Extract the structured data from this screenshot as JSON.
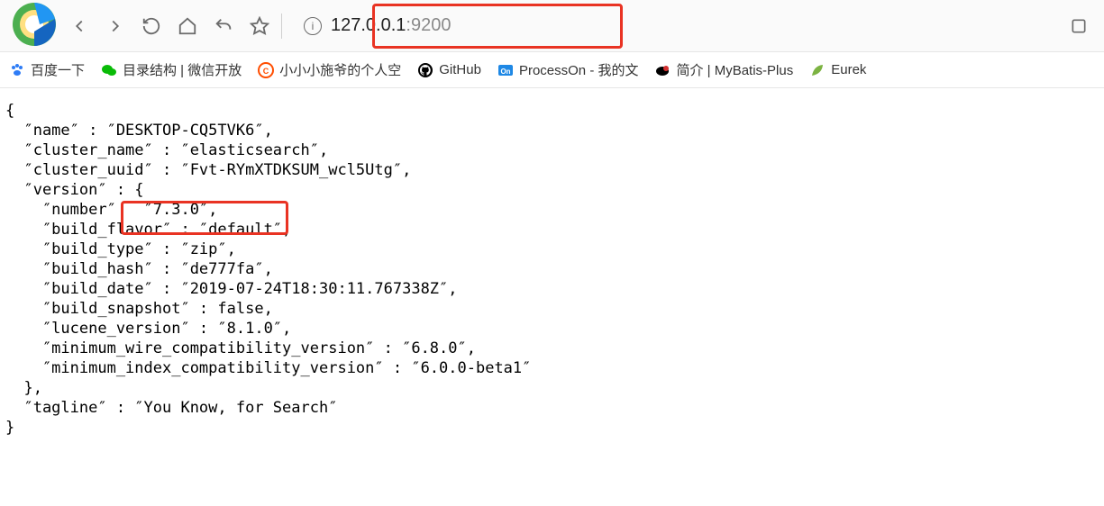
{
  "address": {
    "host": "127.0.0.1",
    "port": ":9200"
  },
  "bookmarks": [
    {
      "label": "百度一下"
    },
    {
      "label": "目录结构 | 微信开放"
    },
    {
      "label": "小小小施爷的个人空"
    },
    {
      "label": "GitHub"
    },
    {
      "label": "ProcessOn - 我的文"
    },
    {
      "label": "简介 | MyBatis-Plus"
    },
    {
      "label": "Eurek"
    }
  ],
  "json": {
    "name": "DESKTOP-CQ5TVK6",
    "cluster_name": "elasticsearch",
    "cluster_uuid": "Fvt-RYmXTDKSUM_wcl5Utg",
    "version": {
      "number": "7.3.0",
      "build_flavor": "default",
      "build_type": "zip",
      "build_hash": "de777fa",
      "build_date": "2019-07-24T18:30:11.767338Z",
      "build_snapshot": "false",
      "lucene_version": "8.1.0",
      "minimum_wire_compatibility_version": "6.8.0",
      "minimum_index_compatibility_version": "6.0.0-beta1"
    },
    "tagline": "You Know, for Search"
  }
}
